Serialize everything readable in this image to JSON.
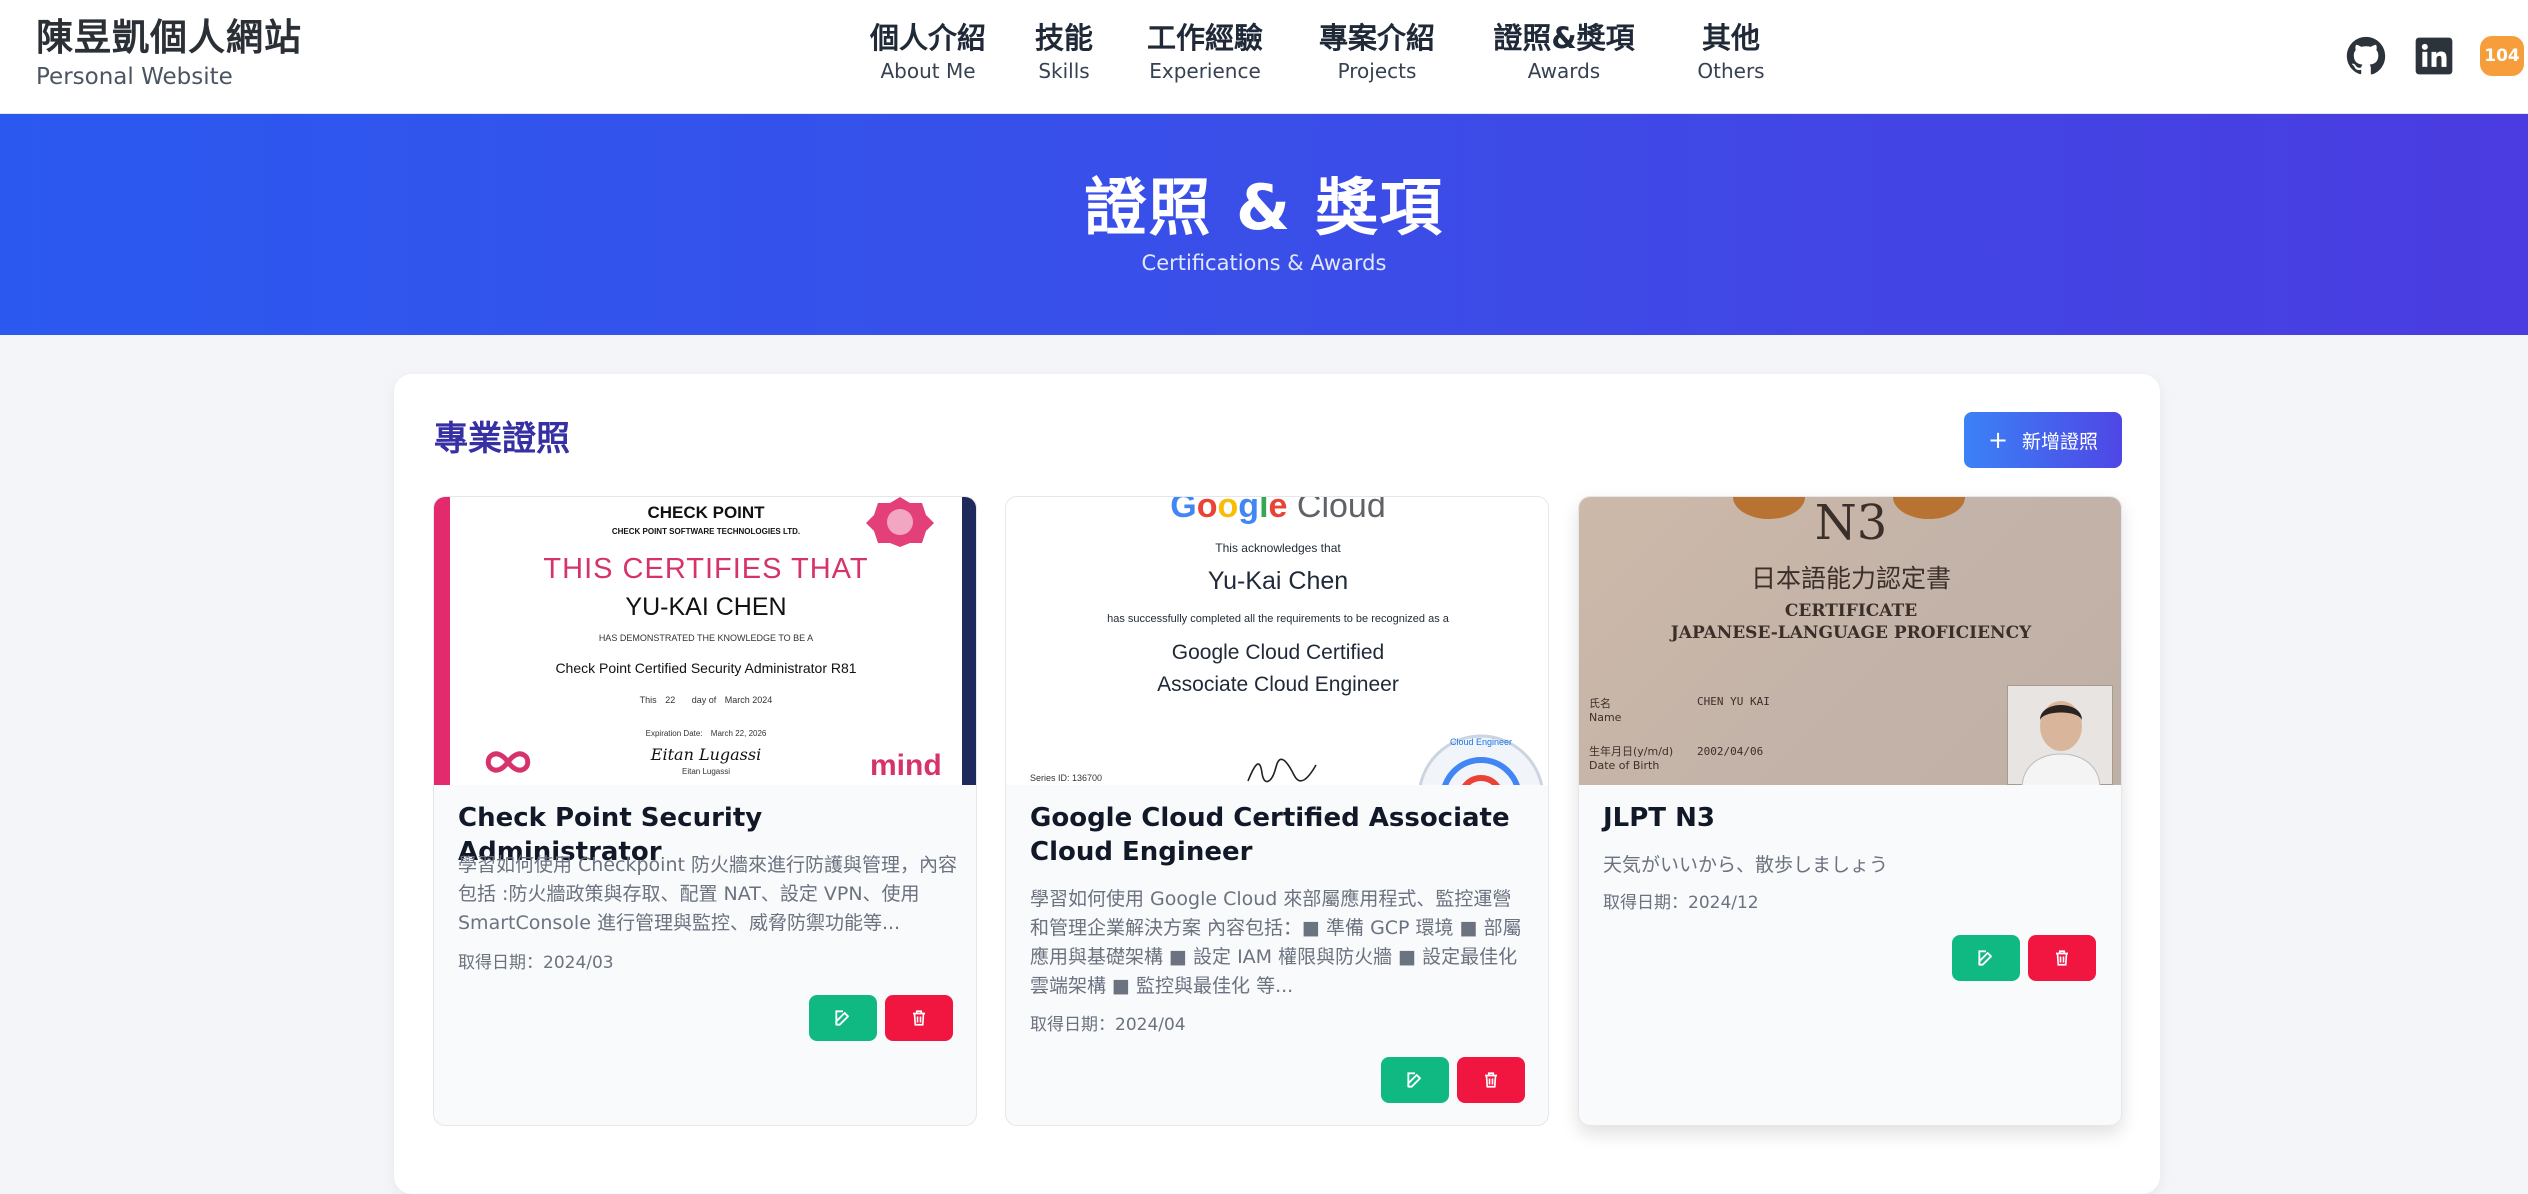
{
  "header": {
    "title": "陳昱凱個人網站",
    "subtitle": "Personal Website",
    "nav": [
      {
        "cn": "個人介紹",
        "en": "About Me"
      },
      {
        "cn": "技能",
        "en": "Skills"
      },
      {
        "cn": "工作經驗",
        "en": "Experience"
      },
      {
        "cn": "專案介紹",
        "en": "Projects"
      },
      {
        "cn": "證照&獎項",
        "en": "Awards"
      },
      {
        "cn": "其他",
        "en": "Others"
      }
    ],
    "social": {
      "github": "github-icon",
      "linkedin": "linkedin-icon",
      "badge_104": "104"
    }
  },
  "hero": {
    "title": "證照 & 獎項",
    "subtitle": "Certifications & Awards"
  },
  "section": {
    "title": "專業證照",
    "add_label": "新增證照"
  },
  "cards": [
    {
      "title": "Check Point Security Administrator",
      "description": "學習如何使用 Checkpoint 防火牆來進行防護與管理，內容包括 :防火牆政策與存取、配置 NAT、設定 VPN、使用 SmartConsole 進行管理與監控、威脅防禦功能等...",
      "date": "取得日期：2024/03",
      "image": {
        "brand": "CHECK POINT",
        "company": "CHECK POINT SOFTWARE TECHNOLOGIES LTD.",
        "headline": "THIS CERTIFIES THAT",
        "name": "YU-KAI CHEN",
        "line": "HAS DEMONSTRATED THE KNOWLEDGE TO BE A",
        "cert": "Check Point Certified Security Administrator R81",
        "day_prefix": "This",
        "day": "22",
        "day_mid": "day of",
        "month": "March 2024",
        "exp_label": "Expiration Date:",
        "exp": "March 22, 2026",
        "signature": "Eitan Lugassi",
        "signer": "Eitan Lugassi",
        "mind": "mind"
      }
    },
    {
      "title": "Google Cloud Certified Associate Cloud Engineer",
      "description": "學習如何使用 Google Cloud 來部屬應用程式、監控運營和管理企業解決方案 內容包括：■ 準備 GCP 環境 ■ 部屬應用與基礎架構 ■ 設定 IAM 權限與防火牆 ■ 設定最佳化雲端架構 ■ 監控與最佳化 等...",
      "date": "取得日期：2024/04",
      "image": {
        "brand": "Google Cloud",
        "acknowledges": "This acknowledges that",
        "name": "Yu-Kai Chen",
        "line": "has successfully completed all the requirements to be recognized as a",
        "cert1": "Google Cloud Certified",
        "cert2": "Associate Cloud Engineer",
        "series": "Series ID: 136700",
        "seal": "Cloud Engineer"
      }
    },
    {
      "title": "JLPT N3",
      "description": "天気がいいから、散歩しましょう",
      "date": "取得日期：2024/12",
      "image": {
        "level": "N3",
        "jp_title": "日本語能力認定書",
        "en1": "CERTIFICATE",
        "en2": "JAPANESE-LANGUAGE PROFICIENCY",
        "name_label": "氏名",
        "name_label_en": "Name",
        "name": "CHEN YU KAI",
        "dob_label": "生年月日(y/m/d)",
        "dob_label_en": "Date of Birth",
        "dob": "2002/04/06"
      }
    }
  ],
  "colors": {
    "accent": "#3b4fe6",
    "edit": "#10b981",
    "delete": "#f0163f",
    "section_title": "#3730a3"
  }
}
